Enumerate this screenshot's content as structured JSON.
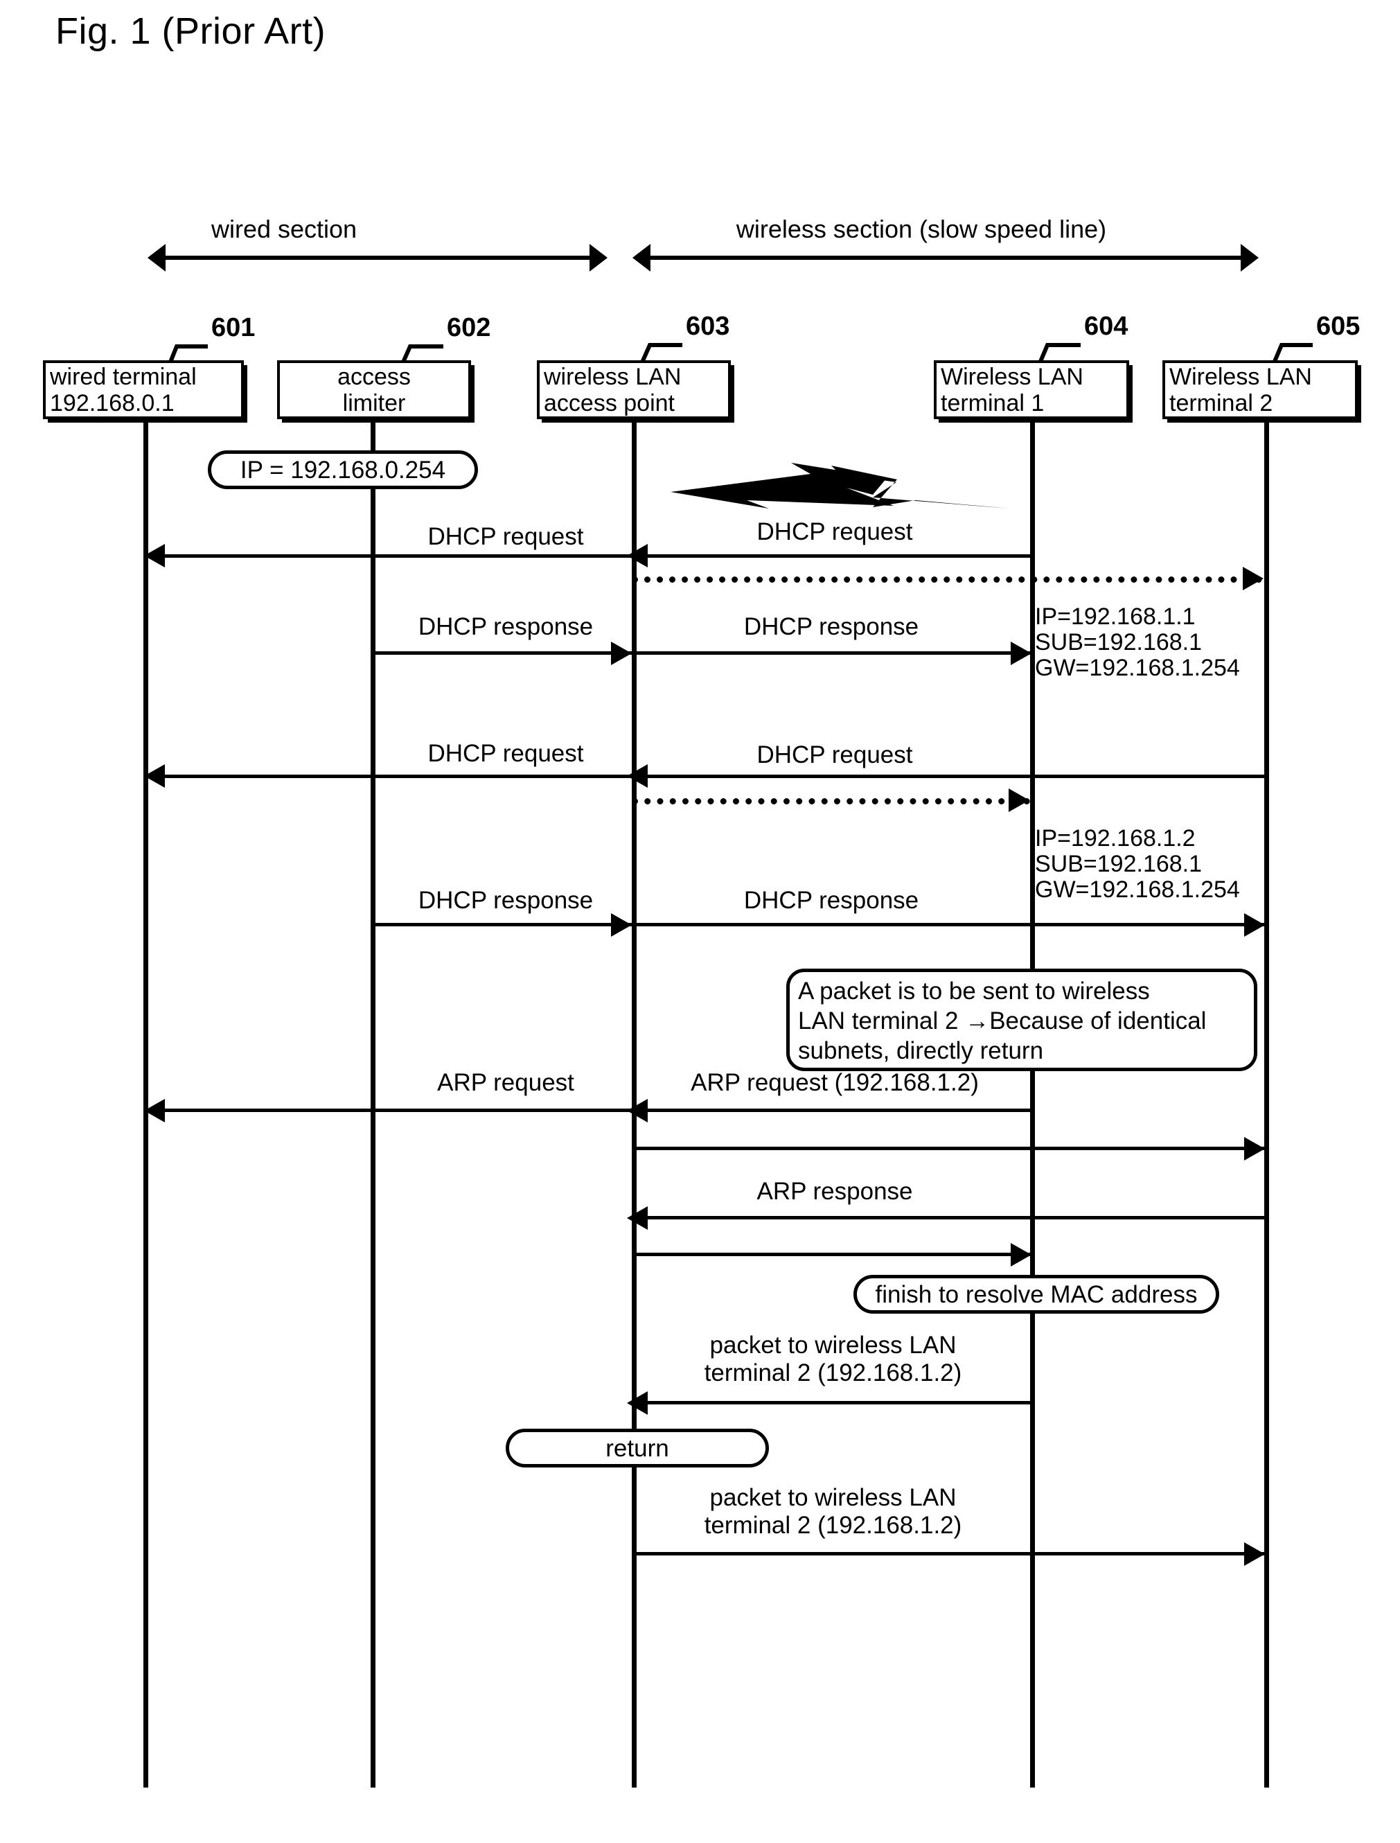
{
  "figure": {
    "title": "Fig. 1 (Prior Art)"
  },
  "sections": [
    {
      "label": "wired section"
    },
    {
      "label": "wireless section (slow speed line)"
    }
  ],
  "actors": [
    {
      "ref": "601",
      "lines": [
        "wired terminal",
        "192.168.0.1"
      ]
    },
    {
      "ref": "602",
      "lines": [
        "access",
        "limiter"
      ]
    },
    {
      "ref": "603",
      "lines": [
        "wireless LAN",
        "access point"
      ]
    },
    {
      "ref": "604",
      "lines": [
        "Wireless LAN",
        "terminal 1"
      ]
    },
    {
      "ref": "605",
      "lines": [
        "Wireless LAN",
        "terminal 2"
      ]
    }
  ],
  "balloons": {
    "ip_assign": "IP = 192.168.0.254",
    "resolve_mac": "finish to resolve MAC address",
    "return": "return"
  },
  "note": {
    "line1": "A packet is to be sent to wireless",
    "line2": "LAN terminal 2  →Because of identical",
    "line3": "subnets, directly return"
  },
  "info_blocks": [
    {
      "line1": "IP=192.168.1.1",
      "line2": "SUB=192.168.1",
      "line3": "GW=192.168.1.254"
    },
    {
      "line1": "IP=192.168.1.2",
      "line2": "SUB=192.168.1",
      "line3": "GW=192.168.1.254"
    }
  ],
  "messages": {
    "dhcp_request_1a": "DHCP request",
    "dhcp_request_1b": "DHCP request",
    "dhcp_response_1a": "DHCP response",
    "dhcp_response_1b": "DHCP response",
    "dhcp_request_2a": "DHCP request",
    "dhcp_request_2b": "DHCP request",
    "dhcp_response_2a": "DHCP response",
    "dhcp_response_2b": "DHCP response",
    "arp_request_a": "ARP request",
    "arp_request_b": "ARP request (192.168.1.2)",
    "arp_response": "ARP response",
    "packet_1_l1": "packet to wireless LAN",
    "packet_1_l2": "terminal 2 (192.168.1.2)",
    "packet_2_l1": "packet to wireless LAN",
    "packet_2_l2": "terminal 2 (192.168.1.2)"
  },
  "colors": {
    "ink": "#000000",
    "paper": "#ffffff"
  }
}
